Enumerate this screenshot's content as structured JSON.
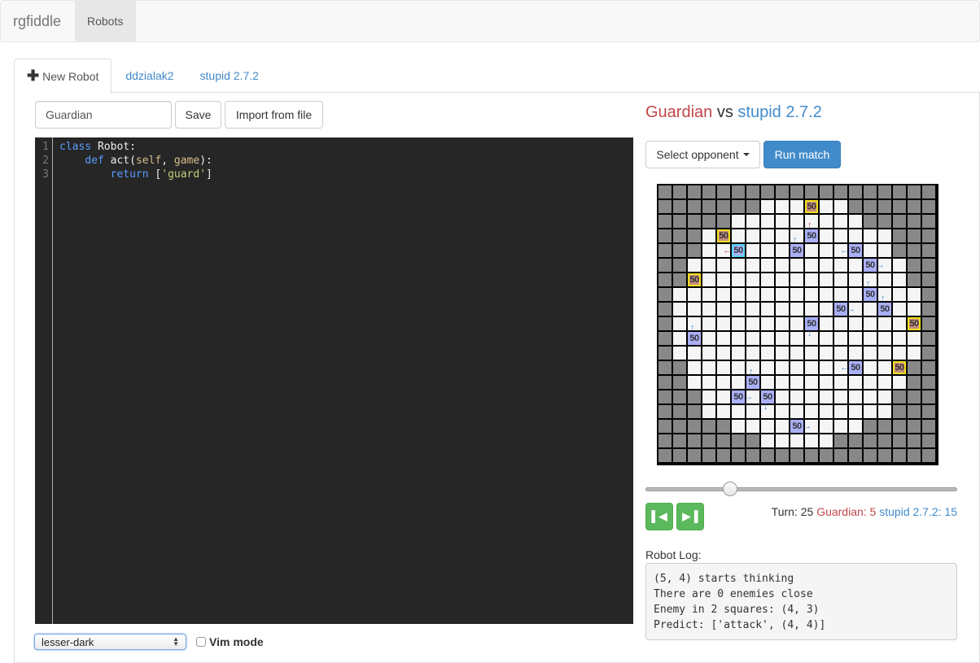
{
  "navbar": {
    "brand": "rgfiddle",
    "items": [
      {
        "label": "Robots",
        "active": true
      }
    ]
  },
  "tabs": [
    {
      "label": "New Robot",
      "icon": "plus-icon",
      "active": true
    },
    {
      "label": "ddzialak2",
      "active": false
    },
    {
      "label": "stupid 2.7.2",
      "active": false
    }
  ],
  "editor_panel": {
    "robot_name": "Guardian",
    "save_label": "Save",
    "import_label": "Import from file",
    "line_numbers": [
      "1",
      "2",
      "3"
    ],
    "code_lines": [
      "class Robot:",
      "    def act(self, game):",
      "        return ['guard']"
    ],
    "theme_select": {
      "selected": "lesser-dark"
    },
    "vim_mode": {
      "label": "Vim mode",
      "checked": false
    }
  },
  "match": {
    "player": "Guardian",
    "vs": "vs",
    "opponent": "stupid 2.7.2",
    "select_opponent_label": "Select opponent",
    "run_match_label": "Run match",
    "colors": {
      "player": "#c0474a",
      "opponent": "#428bca",
      "obstacle": "#888888",
      "floor": "#f5f5f5",
      "red_robot": "#c28e7f",
      "blue_robot": "#aab0f8",
      "highlight": "#f4e01c",
      "selected": "#52d7f5"
    },
    "board": {
      "size": 19,
      "open_ranges": [
        null,
        [
          7,
          12
        ],
        [
          5,
          13
        ],
        [
          3,
          15
        ],
        [
          3,
          15
        ],
        [
          2,
          16
        ],
        [
          2,
          16
        ],
        [
          1,
          17
        ],
        [
          1,
          17
        ],
        [
          1,
          17
        ],
        [
          1,
          17
        ],
        [
          1,
          17
        ],
        [
          2,
          16
        ],
        [
          2,
          16
        ],
        [
          3,
          15
        ],
        [
          3,
          15
        ],
        [
          5,
          13
        ],
        [
          7,
          11
        ],
        null
      ],
      "robots": [
        {
          "row": 1,
          "col": 10,
          "team": "red",
          "hp": "50"
        },
        {
          "row": 3,
          "col": 4,
          "team": "red",
          "hp": "50"
        },
        {
          "row": 3,
          "col": 10,
          "team": "blue",
          "hp": "50",
          "arrow": "up",
          "arrow_color": "red"
        },
        {
          "row": 4,
          "col": 5,
          "team": "blue",
          "hp": "50",
          "arrow": "left",
          "arrow_color": "red",
          "selected": true
        },
        {
          "row": 4,
          "col": 9,
          "team": "blue",
          "hp": "50",
          "arrow": "up"
        },
        {
          "row": 4,
          "col": 13,
          "team": "blue",
          "hp": "50",
          "arrow": "left"
        },
        {
          "row": 5,
          "col": 14,
          "team": "blue",
          "hp": "50",
          "arrow": "right"
        },
        {
          "row": 6,
          "col": 2,
          "team": "red",
          "hp": "50"
        },
        {
          "row": 7,
          "col": 14,
          "team": "blue",
          "hp": "50",
          "arrow": "up"
        },
        {
          "row": 8,
          "col": 12,
          "team": "blue",
          "hp": "50",
          "arrow": "right"
        },
        {
          "row": 8,
          "col": 15,
          "team": "blue",
          "hp": "50",
          "arrow": "up"
        },
        {
          "row": 9,
          "col": 10,
          "team": "blue",
          "hp": "50",
          "arrow": "down"
        },
        {
          "row": 9,
          "col": 17,
          "team": "red",
          "hp": "50"
        },
        {
          "row": 10,
          "col": 2,
          "team": "blue",
          "hp": "50",
          "arrow": "up"
        },
        {
          "row": 12,
          "col": 13,
          "team": "blue",
          "hp": "50",
          "arrow": "left"
        },
        {
          "row": 12,
          "col": 16,
          "team": "red",
          "hp": "50"
        },
        {
          "row": 13,
          "col": 6,
          "team": "blue",
          "hp": "50",
          "arrow": "up"
        },
        {
          "row": 14,
          "col": 5,
          "team": "blue",
          "hp": "50",
          "arrow": "right"
        },
        {
          "row": 14,
          "col": 7,
          "team": "blue",
          "hp": "50",
          "arrow": "down"
        },
        {
          "row": 16,
          "col": 9,
          "team": "blue",
          "hp": "50",
          "arrow": "right"
        }
      ]
    },
    "playback": {
      "turn_progress": 0.26,
      "prev_icon": "step-backward-icon",
      "next_icon": "step-forward-icon"
    },
    "status": {
      "turn_label": "Turn: 25",
      "player_score": "Guardian: 5",
      "opponent_score": "stupid 2.7.2: 15"
    },
    "log": {
      "label": "Robot Log:",
      "lines": [
        "(5, 4) starts thinking",
        "There are 0 enemies close",
        "Enemy in 2 squares: (4, 3)",
        "Predict: ['attack', (4, 4)]"
      ]
    }
  }
}
